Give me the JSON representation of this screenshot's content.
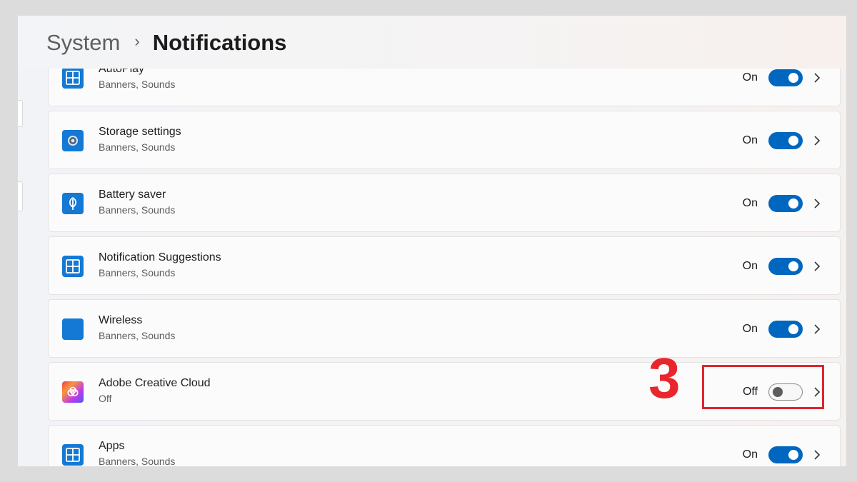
{
  "breadcrumb": {
    "parent": "System",
    "separator": "›",
    "current": "Notifications"
  },
  "apps": [
    {
      "name": "AutoPlay",
      "subtitle": "Banners, Sounds",
      "state": "On",
      "enabled": true,
      "icon": "tiles-icon"
    },
    {
      "name": "Storage settings",
      "subtitle": "Banners, Sounds",
      "state": "On",
      "enabled": true,
      "icon": "storage-gear-icon"
    },
    {
      "name": "Battery saver",
      "subtitle": "Banners, Sounds",
      "state": "On",
      "enabled": true,
      "icon": "leaf-icon"
    },
    {
      "name": "Notification Suggestions",
      "subtitle": "Banners, Sounds",
      "state": "On",
      "enabled": true,
      "icon": "tiles-icon"
    },
    {
      "name": "Wireless",
      "subtitle": "Banners, Sounds",
      "state": "On",
      "enabled": true,
      "icon": "blue-square-icon"
    },
    {
      "name": "Adobe Creative Cloud",
      "subtitle": "Off",
      "state": "Off",
      "enabled": false,
      "icon": "adobe-creative-cloud-icon"
    },
    {
      "name": "Apps",
      "subtitle": "Banners, Sounds",
      "state": "On",
      "enabled": true,
      "icon": "tiles-icon"
    }
  ],
  "annotation": {
    "step": "3",
    "color": "#e1252f"
  },
  "colors": {
    "accent": "#0067c0",
    "icon_blue": "#1479d4"
  }
}
